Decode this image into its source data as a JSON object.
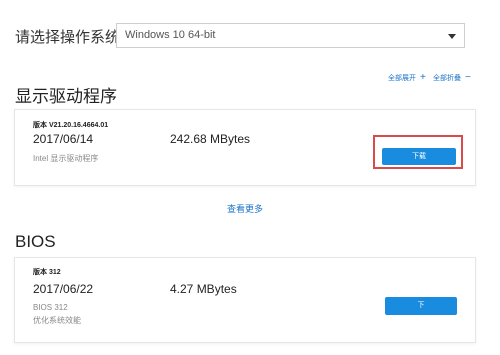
{
  "os": {
    "label": "请选择操作系统",
    "selected": "Windows 10 64-bit"
  },
  "sections": [
    {
      "title": "显示驱动程序",
      "expand_all": "全部展开",
      "collapse_all": "全部折叠",
      "expand_symbol": "+",
      "collapse_symbol": "−",
      "item": {
        "version": "版本 V21.20.16.4664.01",
        "date": "2017/06/14",
        "size": "242.68 MBytes",
        "description": "Intel 显示驱动程序",
        "download_label": "下载"
      },
      "view_more": "查看更多"
    },
    {
      "title": "BIOS",
      "item": {
        "version": "版本 312",
        "date": "2017/06/22",
        "size": "4.27 MBytes",
        "description_lines": [
          "BIOS 312",
          "优化系统效能"
        ],
        "download_label": "下"
      }
    }
  ],
  "colors": {
    "accent": "#1a8cdf",
    "link": "#1a74c9",
    "highlight": "#d94a4a"
  }
}
